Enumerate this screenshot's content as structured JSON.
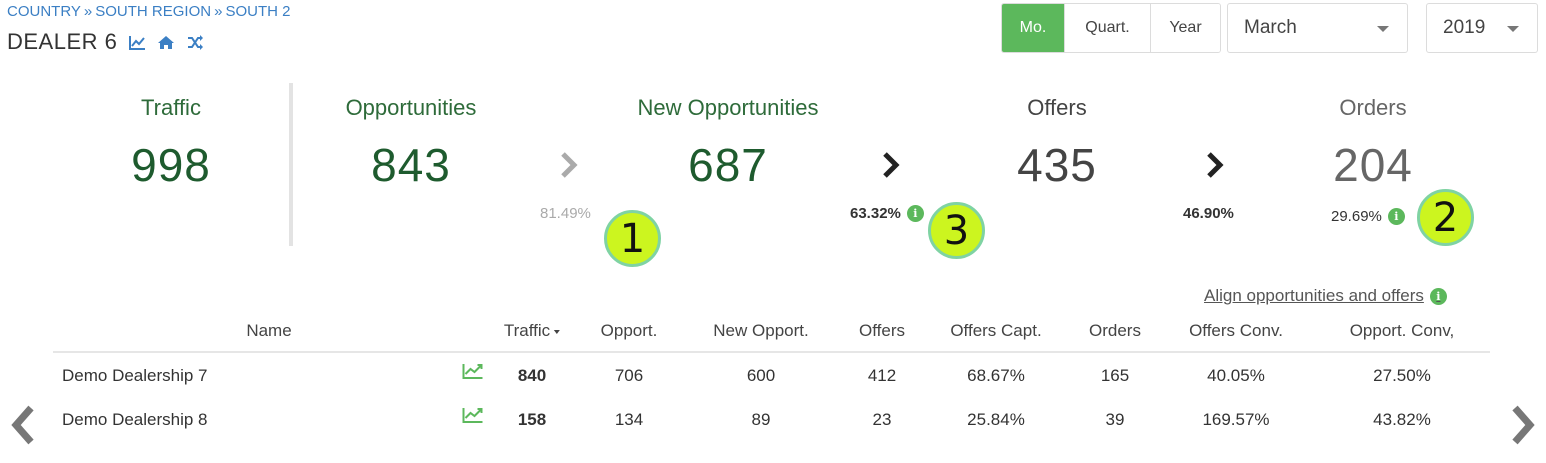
{
  "breadcrumb": {
    "items": [
      "COUNTRY",
      "SOUTH REGION",
      "SOUTH 2"
    ],
    "separator": "»"
  },
  "dealer": {
    "title": "DEALER 6",
    "icons": [
      "trend-chart-icon",
      "home-icon",
      "shuffle-icon"
    ]
  },
  "period_buttons": [
    {
      "label": "Mo.",
      "active": true
    },
    {
      "label": "Quart.",
      "active": false
    },
    {
      "label": "Year",
      "active": false
    }
  ],
  "month_select": {
    "value": "March"
  },
  "year_select": {
    "value": "2019"
  },
  "kpis": {
    "traffic": {
      "label": "Traffic",
      "value": "998"
    },
    "opportunities": {
      "label": "Opportunities",
      "value": "843"
    },
    "new_opportunities": {
      "label": "New Opportunities",
      "value": "687"
    },
    "offers": {
      "label": "Offers",
      "value": "435"
    },
    "orders": {
      "label": "Orders",
      "value": "204"
    }
  },
  "conversions": {
    "opp_to_new": "81.49%",
    "new_to_offers": "63.32%",
    "offers_to_orders": "46.90%",
    "orders_rate": "29.69%"
  },
  "markers": [
    "1",
    "2",
    "3"
  ],
  "align_link": "Align opportunities and offers",
  "table": {
    "headers": [
      "Name",
      "Traffic",
      "Opport.",
      "New Opport.",
      "Offers",
      "Offers Capt.",
      "Orders",
      "Offers Conv.",
      "Opport. Conv,"
    ],
    "rows": [
      {
        "name": "Demo Dealership 7",
        "traffic": "840",
        "opport": "706",
        "new_opport": "600",
        "offers": "412",
        "offers_capt": "68.67%",
        "orders": "165",
        "offers_conv": "40.05%",
        "opport_conv": "27.50%"
      },
      {
        "name": "Demo Dealership 8",
        "traffic": "158",
        "opport": "134",
        "new_opport": "89",
        "offers": "23",
        "offers_capt": "25.84%",
        "orders": "39",
        "offers_conv": "169.57%",
        "opport_conv": "43.82%"
      }
    ]
  },
  "colors": {
    "accent_green": "#5cb85c",
    "kpi_green": "#1e5b2e",
    "link_blue": "#3b7fc4",
    "marker_fill": "#ccf51f"
  }
}
